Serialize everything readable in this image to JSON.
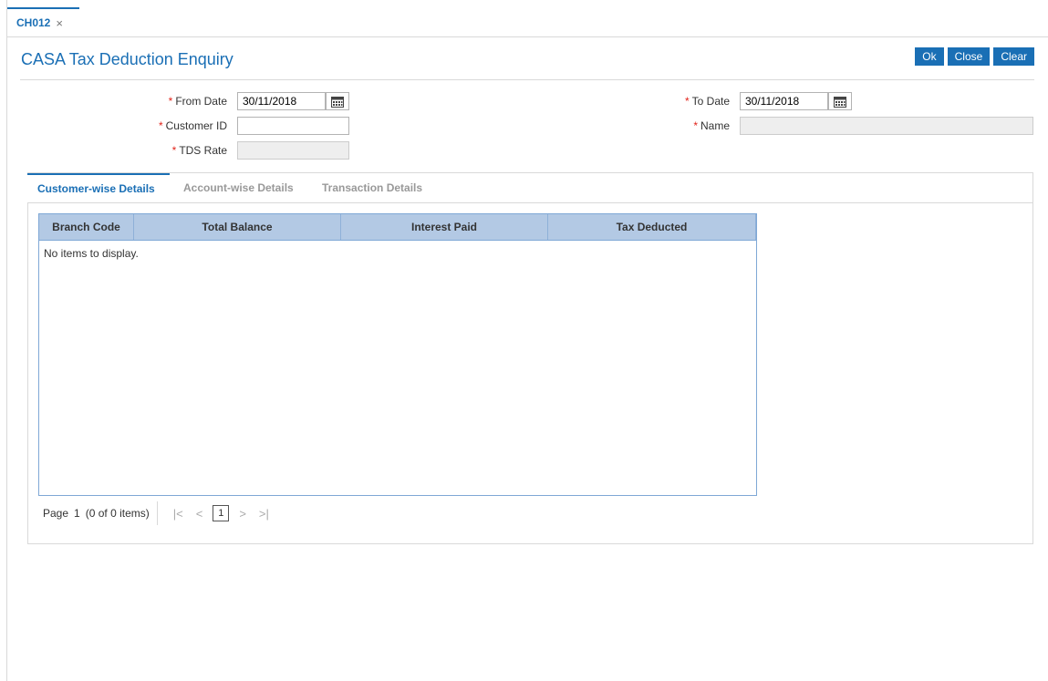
{
  "tab": {
    "label": "CH012",
    "close": "×"
  },
  "page": {
    "title": "CASA Tax Deduction Enquiry"
  },
  "toolbar": {
    "ok": "Ok",
    "close": "Close",
    "clear": "Clear"
  },
  "form": {
    "required_mark": "*",
    "from_date": {
      "label": "From Date",
      "value": "30/11/2018"
    },
    "to_date": {
      "label": "To Date",
      "value": "30/11/2018"
    },
    "customer_id": {
      "label": "Customer ID",
      "value": ""
    },
    "name": {
      "label": "Name",
      "value": ""
    },
    "tds_rate": {
      "label": "TDS Rate",
      "value": ""
    }
  },
  "subtabs": [
    "Customer-wise Details",
    "Account-wise Details",
    "Transaction Details"
  ],
  "grid": {
    "columns": [
      "Branch Code",
      "Total Balance",
      "Interest Paid",
      "Tax Deducted"
    ],
    "empty_text": "No items to display."
  },
  "pager": {
    "label": "Page",
    "page": "1",
    "summary": "(0 of 0 items)",
    "first": "|<",
    "prev": "<",
    "next": ">",
    "last": ">|"
  }
}
